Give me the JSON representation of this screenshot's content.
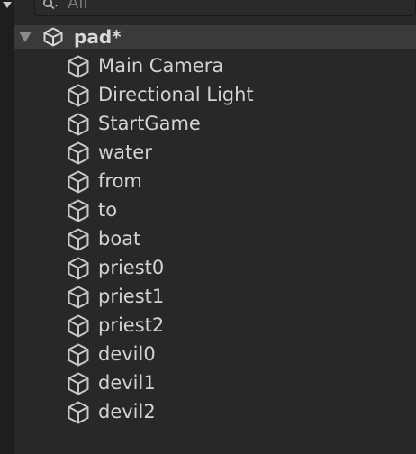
{
  "search": {
    "placeholder": "All"
  },
  "scene": {
    "name": "pad*",
    "expanded": true,
    "icon": "unity-scene-icon"
  },
  "hierarchy": {
    "item_icon": "gameobject-cube-icon",
    "items": [
      {
        "label": "Main Camera"
      },
      {
        "label": "Directional Light"
      },
      {
        "label": "StartGame"
      },
      {
        "label": "water"
      },
      {
        "label": "from"
      },
      {
        "label": "to"
      },
      {
        "label": "boat"
      },
      {
        "label": "priest0"
      },
      {
        "label": "priest1"
      },
      {
        "label": "priest2"
      },
      {
        "label": "devil0"
      },
      {
        "label": "devil1"
      },
      {
        "label": "devil2"
      }
    ]
  },
  "colors": {
    "background": "#282828",
    "scene_row": "#3a3a3a",
    "text": "#d2d2d2",
    "placeholder": "#7a7a7a"
  }
}
